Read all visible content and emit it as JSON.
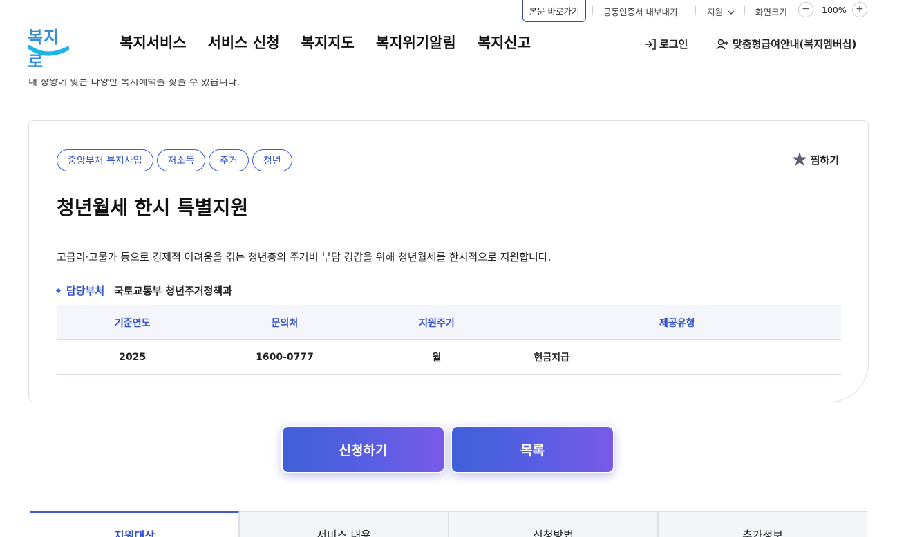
{
  "utility": {
    "skip_link": "본문 바로가기",
    "cert_export": "공동인증서 내보내기",
    "support": "지원",
    "screen_size": "화면크기",
    "zoom_minus": "−",
    "zoom_level": "100%",
    "zoom_plus": "+"
  },
  "header": {
    "logo_text": "복지로",
    "nav": [
      "복지서비스",
      "서비스 신청",
      "복지지도",
      "복지위기알림",
      "복지신고"
    ],
    "login": "로그인",
    "membership": "맞춤형급여안내(복지멤버십)"
  },
  "partial_text": "내 상황에 맞는 다양한 복지혜택을 찾을 수 있습니다.",
  "card": {
    "tags": [
      "중앙부처 복지사업",
      "저소득",
      "주거",
      "청년"
    ],
    "bookmark_label": "찜하기",
    "title": "청년월세 한시 특별지원",
    "description": "고금리·고물가 등으로 경제적 어려움을 겪는 청년층의 주거비 부담 경감을 위해 청년월세를 한시적으로 지원합니다.",
    "dept_label": "담당부처",
    "dept_value": "국토교통부 청년주거정책과",
    "table": {
      "headers": [
        "기준연도",
        "문의처",
        "지원주기",
        "제공유형"
      ],
      "row": [
        "2025",
        "1600-0777",
        "월",
        "현금지급"
      ]
    }
  },
  "buttons": {
    "apply": "신청하기",
    "list": "목록"
  },
  "tabs": [
    "지원대상",
    "서비스 내용",
    "신청방법",
    "추가정보"
  ]
}
